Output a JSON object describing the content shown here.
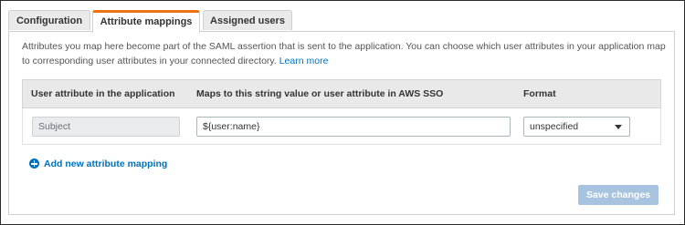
{
  "tabs": [
    {
      "label": "Configuration",
      "active": false
    },
    {
      "label": "Attribute mappings",
      "active": true
    },
    {
      "label": "Assigned users",
      "active": false
    }
  ],
  "description": {
    "text": "Attributes you map here become part of the SAML assertion that is sent to the application. You can choose which user attributes in your application map to corresponding user attributes in your connected directory.",
    "link_label": "Learn more"
  },
  "table": {
    "headers": [
      "User attribute in the application",
      "Maps to this string value or user attribute in AWS SSO",
      "Format"
    ],
    "rows": [
      {
        "app_attribute": "Subject",
        "maps_to": "${user:name}",
        "format": "unspecified"
      }
    ]
  },
  "add_mapping_label": "Add new attribute mapping",
  "save_label": "Save changes",
  "colors": {
    "active_tab_accent": "#ec7211",
    "link": "#0073bb",
    "save_button_disabled": "#a7c3df"
  },
  "icons": {
    "add": "plus-circle-icon",
    "dropdown": "caret-down-icon"
  }
}
